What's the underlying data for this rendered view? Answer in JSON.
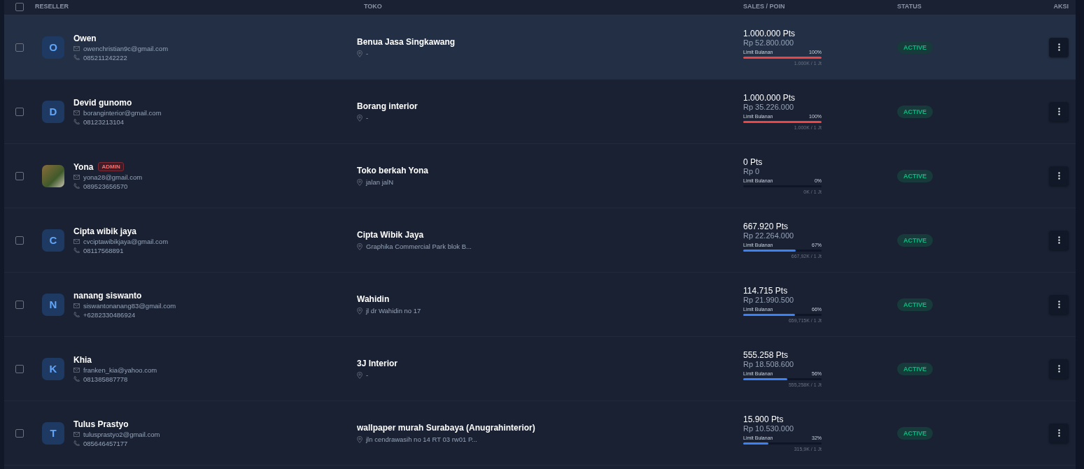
{
  "table": {
    "columns": [
      "RESELLER",
      "TOKO",
      "SALES / POIN",
      "STATUS",
      "AKSI"
    ],
    "select_all": {
      "checked": false
    },
    "rows": [
      {
        "checked": false,
        "highlighted": true,
        "avatar": {
          "kind": "initial",
          "letter": "O"
        },
        "name": "Owen",
        "email": "owenchristian9c@gmail.com",
        "phone": "085211242222",
        "store": "Benua Jasa Singkawang",
        "address": "-",
        "points": "1.000.000 Pts",
        "sales": "Rp 52.800.000",
        "limit_label": "Limit Bulanan",
        "limit_percent": "100%",
        "level": 1,
        "limit_usage": "1.000K / 1 Jt",
        "status": "ACTIVE"
      },
      {
        "checked": false,
        "highlighted": false,
        "avatar": {
          "kind": "initial",
          "letter": "D"
        },
        "name": "Devid gunomo",
        "email": "boranginterior@gmail.com",
        "phone": "08123213104",
        "store": "Borang interior",
        "address": "-",
        "points": "1.000.000 Pts",
        "sales": "Rp 35.226.000",
        "limit_label": "Limit Bulanan",
        "limit_percent": "100%",
        "level": 1,
        "limit_usage": "1.000K / 1 Jt",
        "status": "ACTIVE"
      },
      {
        "checked": false,
        "highlighted": false,
        "avatar": {
          "kind": "photo"
        },
        "name": "Yona",
        "badge": "ADMIN",
        "email": "yona28@gmail.com",
        "phone": "089523656570",
        "store": "Toko berkah Yona",
        "address": "jalan jalN",
        "points": "0 Pts",
        "sales": "Rp 0",
        "limit_label": "Limit Bulanan",
        "limit_percent": "0%",
        "level": 0,
        "limit_usage": "0K / 1 Jt",
        "status": "ACTIVE"
      },
      {
        "checked": false,
        "highlighted": false,
        "avatar": {
          "kind": "initial",
          "letter": "C"
        },
        "name": "Cipta wibik jaya",
        "email": "cvciptawibikjaya@gmail.com",
        "phone": "08117568891",
        "store": "Cipta Wibik Jaya",
        "address": "Graphika Commercial Park blok B...",
        "points": "667.920 Pts",
        "sales": "Rp 22.264.000",
        "limit_label": "Limit Bulanan",
        "limit_percent": "67%",
        "level": 0.67,
        "limit_usage": "667,92K / 1 Jt",
        "status": "ACTIVE"
      },
      {
        "checked": false,
        "highlighted": false,
        "avatar": {
          "kind": "initial",
          "letter": "N"
        },
        "name": "nanang siswanto",
        "email": "siswantonanang83@gmail.com",
        "phone": "+6282330486924",
        "store": "Wahidin",
        "address": "jl dr Wahidin no 17",
        "points": "114.715 Pts",
        "sales": "Rp 21.990.500",
        "limit_label": "Limit Bulanan",
        "limit_percent": "66%",
        "level": 0.66,
        "limit_usage": "659,715K / 1 Jt",
        "status": "ACTIVE"
      },
      {
        "checked": false,
        "highlighted": false,
        "avatar": {
          "kind": "initial",
          "letter": "K"
        },
        "name": "Khia",
        "email": "franken_kia@yahoo.com",
        "phone": "081385887778",
        "store": "3J Interior",
        "address": "-",
        "points": "555.258 Pts",
        "sales": "Rp 18.508.600",
        "limit_label": "Limit Bulanan",
        "limit_percent": "56%",
        "level": 0.56,
        "limit_usage": "555,258K / 1 Jt",
        "status": "ACTIVE"
      },
      {
        "checked": false,
        "highlighted": false,
        "avatar": {
          "kind": "initial",
          "letter": "T"
        },
        "name": "Tulus Prastyo",
        "email": "tulusprastyo2@gmail.com",
        "phone": "085646457177",
        "store": "wallpaper murah Surabaya (Anugrahinterior)",
        "address": "jln cendrawasih no 14 RT 03 rw01 P...",
        "points": "15.900 Pts",
        "sales": "Rp 10.530.000",
        "limit_label": "Limit Bulanan",
        "limit_percent": "32%",
        "level": 0.32,
        "limit_usage": "315,9K / 1 Jt",
        "status": "ACTIVE"
      }
    ]
  }
}
